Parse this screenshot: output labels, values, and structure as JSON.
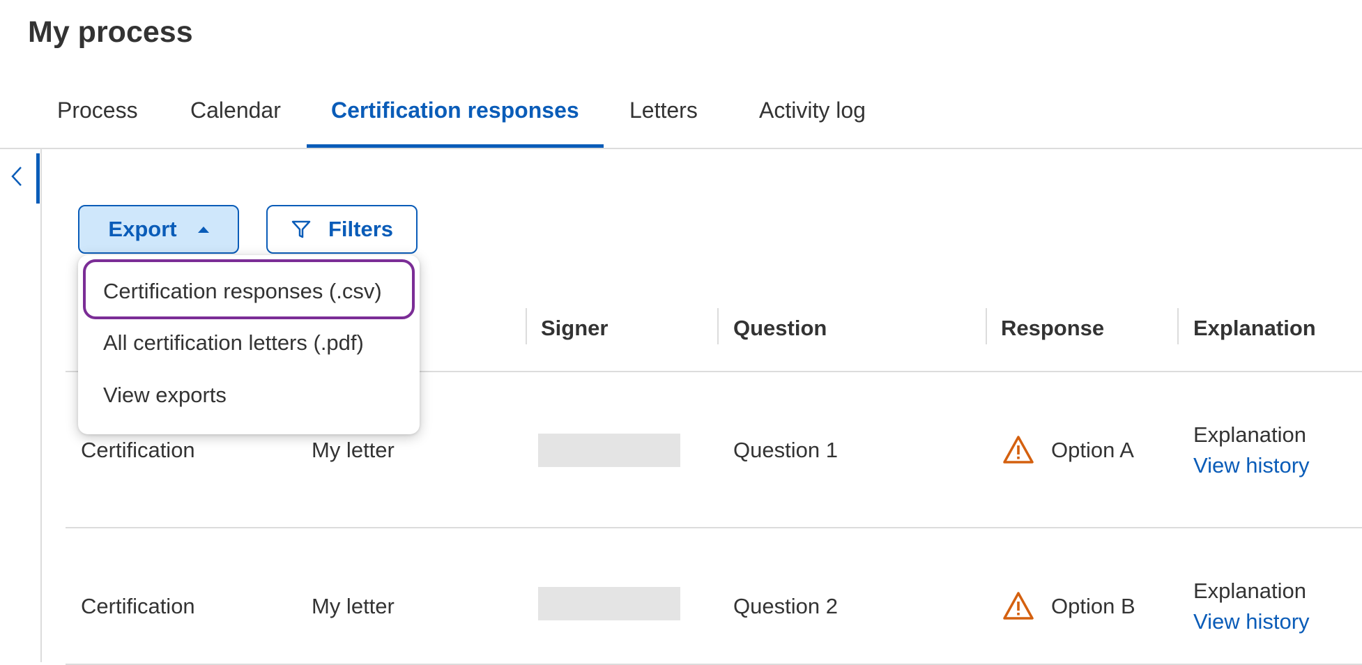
{
  "page": {
    "title": "My process"
  },
  "tabs": [
    {
      "label": "Process",
      "active": false
    },
    {
      "label": "Calendar",
      "active": false
    },
    {
      "label": "Certification responses",
      "active": true
    },
    {
      "label": "Letters",
      "active": false
    },
    {
      "label": "Activity log",
      "active": false
    }
  ],
  "sidebar": {
    "collapse_icon": "chevron-left-icon"
  },
  "toolbar": {
    "export_label": "Export",
    "export_icon": "caret-up-icon",
    "filters_label": "Filters",
    "filters_icon": "funnel-icon"
  },
  "export_menu": {
    "items": [
      {
        "label": "Certification responses (.csv)",
        "focused": true
      },
      {
        "label": "All certification letters (.pdf)",
        "focused": false
      },
      {
        "label": "View exports",
        "focused": false
      }
    ]
  },
  "table": {
    "headers": [
      "Signer",
      "Question",
      "Response",
      "Explanation"
    ],
    "rows": [
      {
        "type": "Certification",
        "letter": "My letter",
        "question": "Question 1",
        "response_icon": "warning-icon",
        "response": "Option A",
        "explanation": "Explanation",
        "history_link": "View history"
      },
      {
        "type": "Certification",
        "letter": "My letter",
        "question": "Question 2",
        "response_icon": "warning-icon",
        "response": "Option B",
        "explanation": "Explanation",
        "history_link": "View history"
      }
    ]
  },
  "colors": {
    "accent": "#0a5cb8",
    "export_button_bg": "#cfe7fb",
    "warning": "#d4600f",
    "focus_ring": "#7b2d96"
  }
}
